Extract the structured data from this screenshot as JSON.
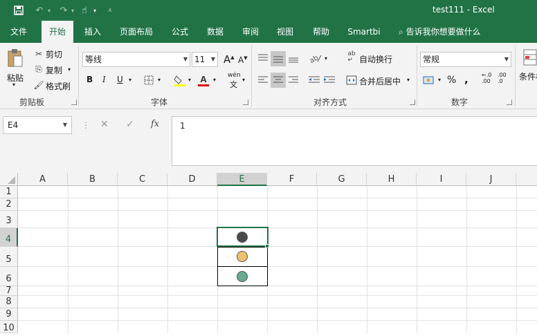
{
  "title_bar": {
    "title": "test111  -  Excel",
    "bg_color": "#217346"
  },
  "tabs": [
    {
      "label": "文件"
    },
    {
      "label": "开始"
    },
    {
      "label": "插入"
    },
    {
      "label": "页面布局"
    },
    {
      "label": "公式"
    },
    {
      "label": "数据"
    },
    {
      "label": "审阅"
    },
    {
      "label": "视图"
    },
    {
      "label": "帮助"
    },
    {
      "label": "Smartbi"
    }
  ],
  "active_tab": "开始",
  "tell_me": "告诉我你想要做什么",
  "clipboard": {
    "paste": "粘贴",
    "cut": "剪切",
    "copy": "复制",
    "format_painter": "格式刷",
    "group": "剪贴板"
  },
  "font": {
    "name": "等线",
    "size": "11",
    "group": "字体",
    "bold": "B",
    "italic": "I",
    "underline": "U",
    "grow": "A",
    "shrink": "A",
    "phonetic": "wén",
    "font_color_glyph": "A"
  },
  "alignment": {
    "wrap": "自动换行",
    "merge": "合并后居中",
    "group": "对齐方式"
  },
  "number": {
    "format": "常规",
    "percent": "%",
    "comma": ",",
    "inc_decimal": ".00",
    "dec_decimal": ".0",
    "group": "数字"
  },
  "styles": {
    "conditional": "条件格"
  },
  "formula_bar": {
    "name_box": "E4",
    "value": "1",
    "fx": "fx"
  },
  "columns": [
    "A",
    "B",
    "C",
    "D",
    "E",
    "F",
    "G",
    "H",
    "I",
    "J"
  ],
  "rows": [
    "1",
    "2",
    "3",
    "4",
    "5",
    "6",
    "7",
    "8",
    "9",
    "10"
  ],
  "selected_cell": "E4",
  "cells": [
    {
      "ref": "E4",
      "value": "1",
      "dot_color": "#4a4a4a"
    },
    {
      "ref": "E5",
      "dot_color": "#f0c070"
    },
    {
      "ref": "E6",
      "dot_color": "#6aaa90"
    }
  ]
}
